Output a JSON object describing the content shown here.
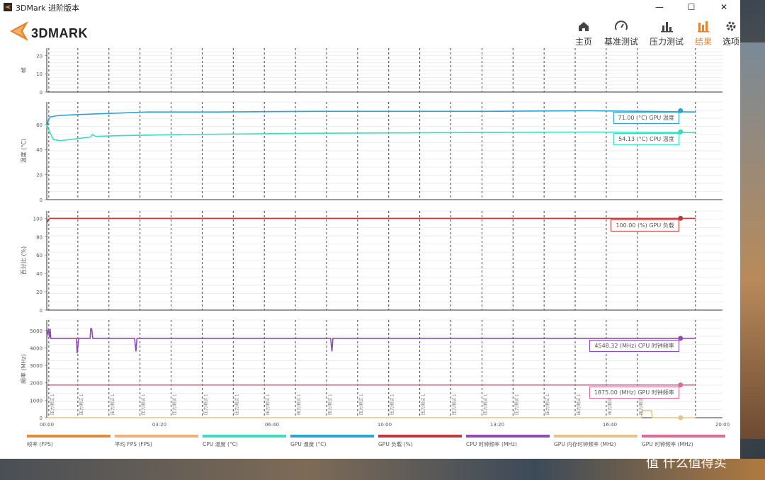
{
  "window": {
    "title": "3DMark 进阶版本",
    "controls": {
      "minimize": "—",
      "maximize": "☐",
      "close": "✕"
    }
  },
  "brand": {
    "name": "3DMARK"
  },
  "nav": [
    {
      "label": "主页",
      "icon": "home-icon",
      "active": false
    },
    {
      "label": "基准测试",
      "icon": "gauge-icon",
      "active": false
    },
    {
      "label": "压力测试",
      "icon": "bar-chart-icon",
      "active": false
    },
    {
      "label": "结果",
      "icon": "results-icon",
      "active": true
    },
    {
      "label": "选项",
      "icon": "gear-icon",
      "active": false
    }
  ],
  "accent_color": "#e8822b",
  "watermark": "值 什么值得买",
  "chart_data": [
    {
      "type": "line",
      "title": "",
      "ylabel": "帧",
      "yticks": [
        0,
        10,
        20
      ],
      "ylim": [
        0,
        24
      ],
      "series": []
    },
    {
      "type": "line",
      "ylabel": "温度 (°C)",
      "yticks": [
        0,
        20,
        40,
        60
      ],
      "ylim": [
        0,
        78
      ],
      "series": [
        {
          "name": "GPU 温度",
          "color": "#2aa3d6",
          "end_value": 71.0,
          "annotation": "71.00 (°C) GPU 温度",
          "x": [
            0,
            0.05,
            0.1,
            0.3,
            0.6,
            1,
            2,
            3,
            5,
            8,
            10,
            13,
            16,
            19.2
          ],
          "values": [
            57,
            64,
            66,
            67,
            67.5,
            68,
            69,
            70,
            70,
            70.5,
            70.5,
            70.5,
            71,
            70
          ]
        },
        {
          "name": "CPU 温度",
          "color": "#3ddcc0",
          "end_value": 54.13,
          "annotation": "54.13 (°C) CPU 温度",
          "x": [
            0,
            0.05,
            0.2,
            0.4,
            0.7,
            1,
            1.3,
            1.35,
            1.45,
            2,
            4,
            8,
            12,
            16,
            19.2
          ],
          "values": [
            60,
            56,
            48,
            47,
            48,
            49,
            50,
            52,
            50.5,
            51,
            52,
            53,
            53.5,
            54,
            53.5
          ]
        }
      ]
    },
    {
      "type": "line",
      "ylabel": "百分比 (%)",
      "yticks": [
        0,
        20,
        40,
        60,
        80,
        100
      ],
      "ylim": [
        0,
        108
      ],
      "series": [
        {
          "name": "GPU 负载",
          "color": "#c0393b",
          "end_value": 100.0,
          "annotation": "100.00 (%) GPU 负载",
          "x": [
            0,
            0.05,
            0.1,
            19.2
          ],
          "values": [
            95,
            99,
            100,
            100
          ]
        }
      ]
    },
    {
      "type": "line",
      "ylabel": "频率 (MHz)",
      "yticks": [
        0,
        1000,
        2000,
        3000,
        4000,
        5000
      ],
      "ylim": [
        0,
        5600
      ],
      "series": [
        {
          "name": "CPU 时钟频率",
          "color": "#8e4bb5",
          "end_value": 4548.32,
          "annotation": "4548.32 (MHz) CPU 时钟频率",
          "x": [
            0,
            0.05,
            0.08,
            0.1,
            0.12,
            0.2,
            0.6,
            0.88,
            0.9,
            0.95,
            1.0,
            1.28,
            1.3,
            1.33,
            1.36,
            1.4,
            2.6,
            2.64,
            2.67,
            2.7,
            8.4,
            8.44,
            8.47,
            8.5,
            19.2
          ],
          "values": [
            4600,
            5100,
            4600,
            5100,
            4550,
            4550,
            4550,
            4550,
            3700,
            4550,
            4550,
            4550,
            5100,
            5100,
            4550,
            4550,
            4550,
            3800,
            4550,
            4550,
            4550,
            3800,
            4550,
            4550,
            4550
          ]
        },
        {
          "name": "GPU 时钟频率",
          "color": "#e06a94",
          "end_value": 1875.0,
          "annotation": "1875.00 (MHz) GPU 时钟频率",
          "x": [
            0,
            19.2
          ],
          "values": [
            1875,
            1875
          ]
        },
        {
          "name": "GPU 内存时钟频率",
          "color": "#e2c58c",
          "end_value": 0,
          "x": [
            0,
            17.6,
            17.62,
            17.9,
            17.92,
            19.2
          ],
          "values": [
            0,
            0,
            400,
            400,
            0,
            0
          ]
        }
      ],
      "markers": {
        "label": "压力测试 1",
        "x": [
          0.06,
          0.92,
          1.84,
          2.76,
          3.68,
          4.6,
          5.52,
          6.44,
          7.36,
          8.28,
          9.2,
          10.12,
          11.04,
          11.96,
          12.88,
          13.8,
          14.72,
          15.64,
          16.56,
          17.48
        ]
      }
    }
  ],
  "xaxis": {
    "ticks": [
      "00:00",
      "03:20",
      "06:40",
      "10:00",
      "13:20",
      "16:40",
      "20:00"
    ],
    "xlim": [
      0,
      20
    ]
  },
  "legend": [
    {
      "label": "帧率 (FPS)",
      "color": "#e28a3c"
    },
    {
      "label": "平均 FPS (FPS)",
      "color": "#efae7a"
    },
    {
      "label": "CPU 温度 (°C)",
      "color": "#3ddcc0"
    },
    {
      "label": "GPU 温度 (°C)",
      "color": "#2aa3d6"
    },
    {
      "label": "GPU 负载 (%)",
      "color": "#c0393b"
    },
    {
      "label": "CPU 时钟频率 (MHz)",
      "color": "#8e4bb5"
    },
    {
      "label": "GPU 内存时钟频率 (MHz)",
      "color": "#e2c58c"
    },
    {
      "label": "GPU 时钟频率 (MHz)",
      "color": "#e06a94"
    }
  ]
}
